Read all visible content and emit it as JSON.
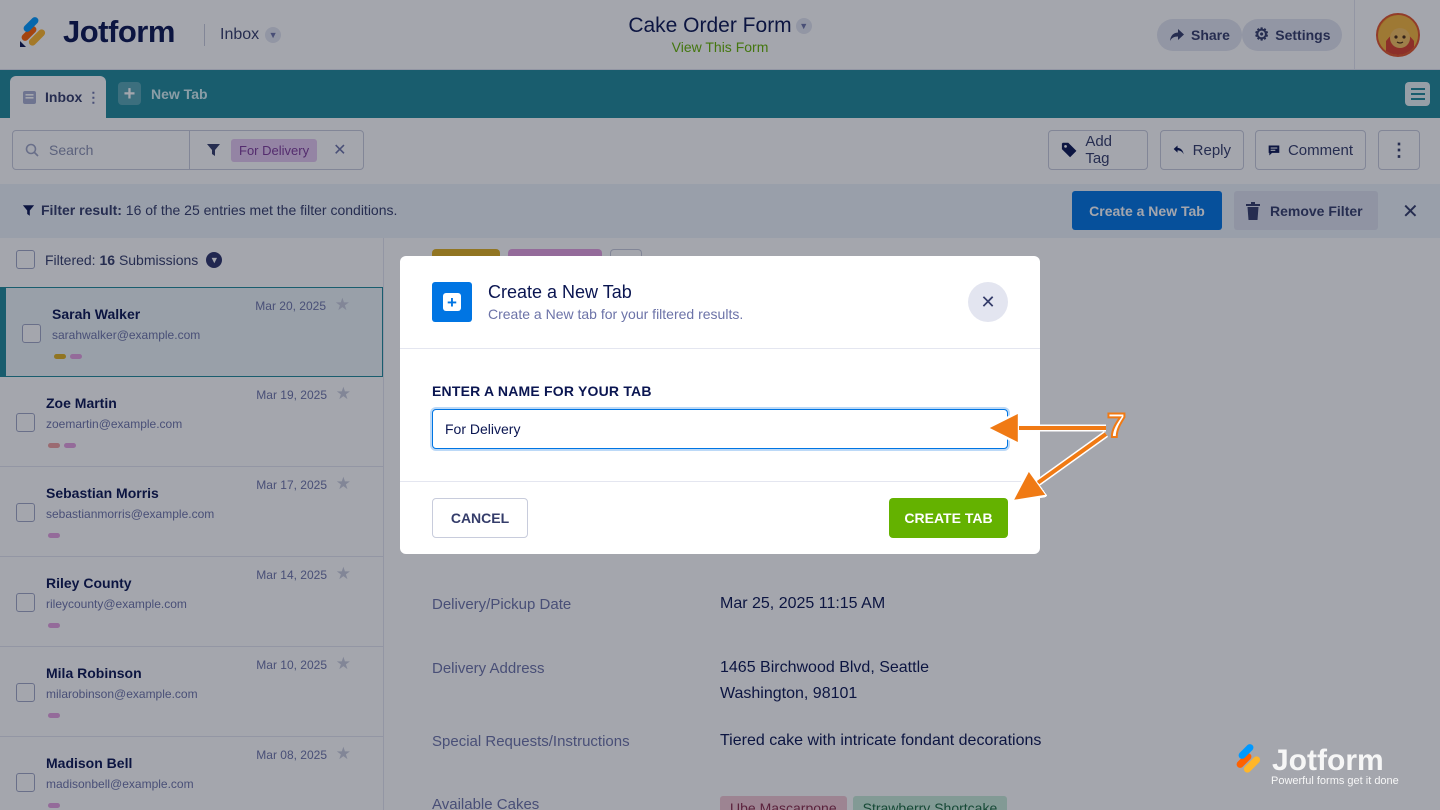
{
  "header": {
    "brand": "Jotform",
    "inbox_label": "Inbox",
    "form_title": "Cake Order Form",
    "form_link": "View This Form",
    "share_label": "Share",
    "settings_label": "Settings"
  },
  "tabs": {
    "inbox_label": "Inbox",
    "new_tab_label": "New Tab"
  },
  "toolbar": {
    "search_placeholder": "Search",
    "filter_chip": "For Delivery",
    "add_tag_label": "Add Tag",
    "reply_label": "Reply",
    "comment_label": "Comment"
  },
  "filter_bar": {
    "prefix": "Filter result:",
    "text": "16 of the 25 entries met the filter conditions.",
    "create_tab_label": "Create a New Tab",
    "remove_filter_label": "Remove Filter"
  },
  "list": {
    "filtered_prefix": "Filtered:",
    "count": "16",
    "suffix": "Submissions",
    "items": [
      {
        "name": "Sarah Walker",
        "email": "sarahwalker@example.com",
        "date": "Mar 20, 2025",
        "tag_colors": [
          "#e0b020",
          "#e6a0e0"
        ]
      },
      {
        "name": "Zoe Martin",
        "email": "zoemartin@example.com",
        "date": "Mar 19, 2025",
        "tag_colors": [
          "#f0a0a0",
          "#e6a0e0"
        ]
      },
      {
        "name": "Sebastian Morris",
        "email": "sebastianmorris@example.com",
        "date": "Mar 17, 2025",
        "tag_colors": [
          "#e6a0e0"
        ]
      },
      {
        "name": "Riley County",
        "email": "rileycounty@example.com",
        "date": "Mar 14, 2025",
        "tag_colors": [
          "#e6a0e0"
        ]
      },
      {
        "name": "Mila Robinson",
        "email": "milarobinson@example.com",
        "date": "Mar 10, 2025",
        "tag_colors": [
          "#e6a0e0"
        ]
      },
      {
        "name": "Madison Bell",
        "email": "madisonbell@example.com",
        "date": "Mar 08, 2025",
        "tag_colors": [
          "#e6a0e0"
        ]
      }
    ]
  },
  "detail": {
    "fields": [
      {
        "label": "Delivery/Pickup Date",
        "value": "Mar 25, 2025 11:15 AM"
      },
      {
        "label": "Delivery Address",
        "value_lines": [
          "1465 Birchwood Blvd, Seattle",
          "Washington, 98101"
        ]
      },
      {
        "label": "Special Requests/Instructions",
        "value": "Tiered cake with intricate fondant decorations"
      },
      {
        "label": "Available Cakes",
        "chips": [
          "Ube Mascarpone",
          "Strawberry Shortcake"
        ]
      }
    ]
  },
  "modal": {
    "title": "Create a New Tab",
    "subtitle": "Create a New tab for your filtered results.",
    "field_label": "ENTER A NAME FOR YOUR TAB",
    "input_value": "For Delivery",
    "cancel_label": "CANCEL",
    "create_label": "CREATE TAB"
  },
  "annotation": {
    "step": "7",
    "color": "#f07a14"
  },
  "watermark": {
    "brand": "Jotform",
    "tagline": "Powerful forms get it done"
  },
  "colors": {
    "teal": "#1f8a9a",
    "blue": "#0075e3",
    "green": "#64b200",
    "navy": "#0a1551"
  }
}
